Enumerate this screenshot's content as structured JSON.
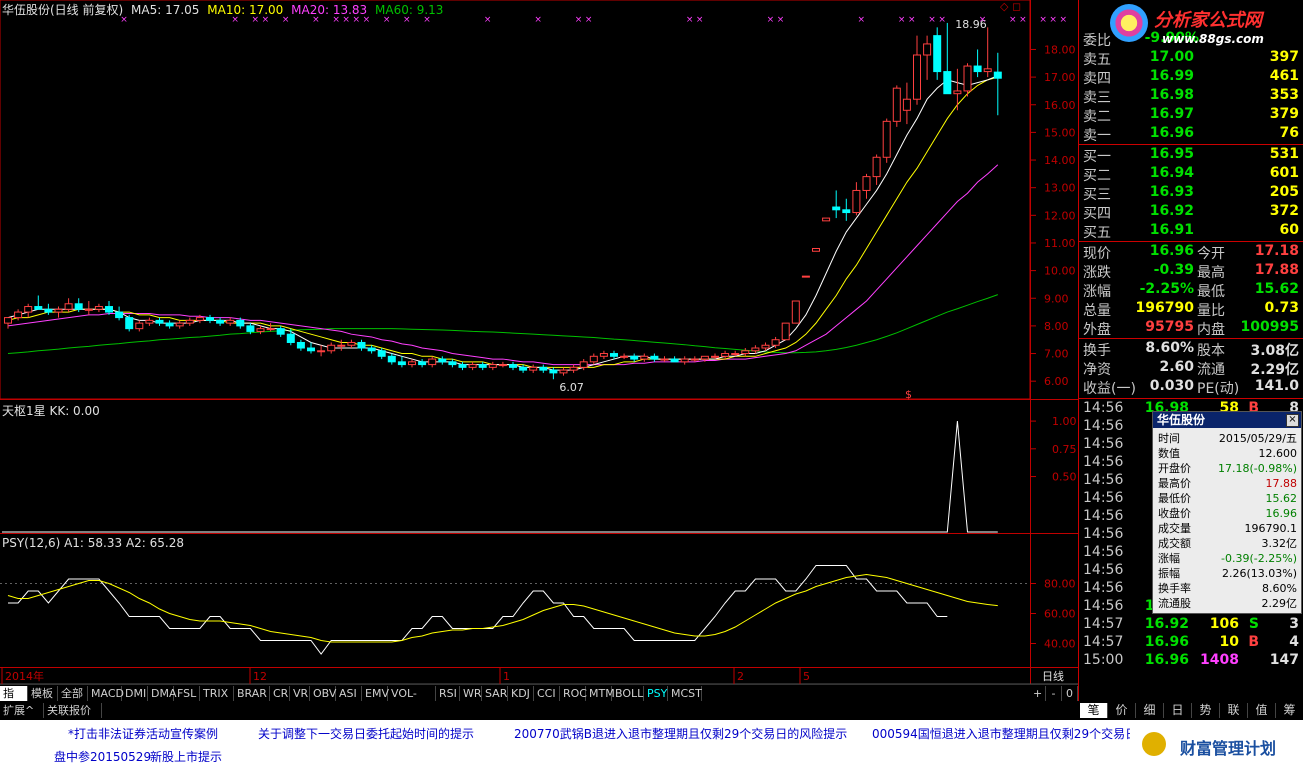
{
  "header": {
    "stock_title": "华伍股份(日线 前复权)",
    "ma5": "MA5: 17.05",
    "ma10": "MA10: 17.00",
    "ma20": "MA20: 13.83",
    "ma60": "MA60: 9.13"
  },
  "price_axis": [
    "18.00",
    "17.00",
    "16.00",
    "15.00",
    "14.00",
    "13.00",
    "12.00",
    "11.00",
    "10.00",
    "9.00",
    "8.00",
    "7.00",
    "6.00"
  ],
  "annotations": {
    "high": "18.96",
    "low": "6.07",
    "marker": "$"
  },
  "indicator1": {
    "title": "天枢1星  KK: 0.00",
    "axis": [
      "1.00",
      "0.75",
      "0.50"
    ]
  },
  "indicator2": {
    "title": "PSY(12,6)  A1: 58.33  A2: 65.28",
    "axis": [
      "80.00",
      "60.00",
      "40.00"
    ]
  },
  "time_axis": {
    "year": "2014年",
    "m12": "12",
    "m1": "1",
    "m2": "2",
    "m5": "5",
    "period": "日线"
  },
  "tabs": [
    "指标",
    "模板",
    "全部",
    "MACD",
    "DMI",
    "DMA",
    "FSL",
    "TRIX",
    "BRAR",
    "CR",
    "VR",
    "OBV",
    "ASI",
    "EMV",
    "VOL-TDX",
    "RSI",
    "WR",
    "SAR",
    "KDJ",
    "CCI",
    "ROC",
    "MTM",
    "BOLL",
    "PSY",
    "MCST"
  ],
  "tab_controls": [
    "+",
    "-",
    "0"
  ],
  "ext_tabs": [
    "扩展^",
    "关联报价"
  ],
  "order_book": {
    "header_label": "委比",
    "header_value": "-9.90%",
    "sell": [
      {
        "label": "卖五",
        "price": "17.00",
        "vol": "397"
      },
      {
        "label": "卖四",
        "price": "16.99",
        "vol": "461"
      },
      {
        "label": "卖三",
        "price": "16.98",
        "vol": "353"
      },
      {
        "label": "卖二",
        "price": "16.97",
        "vol": "379"
      },
      {
        "label": "卖一",
        "price": "16.96",
        "vol": "76"
      }
    ],
    "buy": [
      {
        "label": "买一",
        "price": "16.95",
        "vol": "531"
      },
      {
        "label": "买二",
        "price": "16.94",
        "vol": "601"
      },
      {
        "label": "买三",
        "price": "16.93",
        "vol": "205"
      },
      {
        "label": "买四",
        "price": "16.92",
        "vol": "372"
      },
      {
        "label": "买五",
        "price": "16.91",
        "vol": "60"
      }
    ]
  },
  "quote": [
    {
      "l1": "现价",
      "v1": "16.96",
      "l2": "今开",
      "v2": "17.18"
    },
    {
      "l1": "涨跌",
      "v1": "-0.39",
      "l2": "最高",
      "v2": "17.88"
    },
    {
      "l1": "涨幅",
      "v1": "-2.25%",
      "l2": "最低",
      "v2": "15.62"
    },
    {
      "l1": "总量",
      "v1": "196790",
      "l2": "量比",
      "v2": "0.73"
    },
    {
      "l1": "外盘",
      "v1": "95795",
      "l2": "内盘",
      "v2": "100995"
    }
  ],
  "fundamentals": [
    {
      "l1": "换手",
      "v1": "8.60%",
      "l2": "股本",
      "v2": "3.08亿"
    },
    {
      "l1": "净资",
      "v1": "2.60",
      "l2": "流通",
      "v2": "2.29亿"
    },
    {
      "l1": "收益(一)",
      "v1": "0.030",
      "l2": "PE(动)",
      "v2": "141.0"
    }
  ],
  "ticks": [
    {
      "t": "14:56",
      "p": "16.98",
      "v": "58",
      "f": "B",
      "n": "8"
    },
    {
      "t": "14:56",
      "p": "",
      "v": "",
      "f": "",
      "n": ""
    },
    {
      "t": "14:56",
      "p": "",
      "v": "",
      "f": "",
      "n": ""
    },
    {
      "t": "14:56",
      "p": "",
      "v": "",
      "f": "",
      "n": ""
    },
    {
      "t": "14:56",
      "p": "",
      "v": "",
      "f": "",
      "n": ""
    },
    {
      "t": "14:56",
      "p": "",
      "v": "",
      "f": "",
      "n": ""
    },
    {
      "t": "14:56",
      "p": "",
      "v": "",
      "f": "",
      "n": ""
    },
    {
      "t": "14:56",
      "p": "",
      "v": "",
      "f": "",
      "n": ""
    },
    {
      "t": "14:56",
      "p": "",
      "v": "",
      "f": "",
      "n": ""
    },
    {
      "t": "14:56",
      "p": "",
      "v": "",
      "f": "",
      "n": ""
    },
    {
      "t": "14:56",
      "p": "",
      "v": "",
      "f": "",
      "n": ""
    },
    {
      "t": "14:56",
      "p": "16.92",
      "v": "31",
      "f": "S",
      "n": "6"
    },
    {
      "t": "14:57",
      "p": "16.92",
      "v": "106",
      "f": "S",
      "n": "3"
    },
    {
      "t": "14:57",
      "p": "16.96",
      "v": "10",
      "f": "B",
      "n": "4"
    },
    {
      "t": "15:00",
      "p": "16.96",
      "v": "1408",
      "f": "",
      "n": "147"
    }
  ],
  "popup": {
    "title": "华伍股份",
    "close": "×",
    "rows": [
      {
        "k": "时间",
        "v": "2015/05/29/五"
      },
      {
        "k": "数值",
        "v": "12.600"
      },
      {
        "k": "开盘价",
        "v": "17.18(-0.98%)"
      },
      {
        "k": "最高价",
        "v": "17.88"
      },
      {
        "k": "最低价",
        "v": "15.62"
      },
      {
        "k": "收盘价",
        "v": "16.96"
      },
      {
        "k": "成交量",
        "v": "196790.1"
      },
      {
        "k": "成交额",
        "v": "3.32亿"
      },
      {
        "k": "涨幅",
        "v": "-0.39(-2.25%)"
      },
      {
        "k": "振幅",
        "v": "2.26(13.03%)"
      },
      {
        "k": "换手率",
        "v": "8.60%"
      },
      {
        "k": "流通股",
        "v": "2.29亿"
      }
    ]
  },
  "bottom_tabs": [
    "笔",
    "价",
    "细",
    "日",
    "势",
    "联",
    "值",
    "筹"
  ],
  "news": [
    "*打击非法证券活动宣传案例",
    "关于调整下一交易日委托起始时间的提示",
    "200770武锅B退进入退市整理期且仅剩29个交易日的风险提示",
    "000594国恒退进入退市整理期且仅剩29个交易日的",
    "盘中参20150529",
    "新股上市提示"
  ],
  "watermark": {
    "brand": "分析家公式网",
    "url": "www.88gs.com",
    "plan": "财富管理计划"
  },
  "colors": {
    "up": "#ff4040",
    "down": "#00ffff",
    "ma5": "#ffffff",
    "ma10": "#ffff00",
    "ma20": "#ff40ff",
    "ma60": "#00c000",
    "grid": "#c00000"
  },
  "chart_data": {
    "type": "candlestick",
    "ylim": [
      5.5,
      19.5
    ],
    "candles": [
      [
        8.1,
        8.3,
        7.9,
        8.3
      ],
      [
        8.3,
        8.6,
        8.2,
        8.5
      ],
      [
        8.5,
        8.8,
        8.3,
        8.7
      ],
      [
        8.7,
        9.1,
        8.6,
        8.6
      ],
      [
        8.6,
        8.8,
        8.4,
        8.5
      ],
      [
        8.5,
        8.7,
        8.3,
        8.6
      ],
      [
        8.6,
        9.0,
        8.5,
        8.8
      ],
      [
        8.8,
        9.0,
        8.5,
        8.6
      ],
      [
        8.6,
        8.9,
        8.4,
        8.6
      ],
      [
        8.6,
        8.8,
        8.5,
        8.7
      ],
      [
        8.7,
        8.9,
        8.4,
        8.5
      ],
      [
        8.5,
        8.7,
        8.2,
        8.3
      ],
      [
        8.3,
        8.4,
        7.8,
        7.9
      ],
      [
        7.9,
        8.2,
        7.8,
        8.1
      ],
      [
        8.1,
        8.3,
        8.0,
        8.2
      ],
      [
        8.2,
        8.3,
        8.0,
        8.1
      ],
      [
        8.1,
        8.2,
        7.9,
        8.0
      ],
      [
        8.0,
        8.2,
        7.9,
        8.1
      ],
      [
        8.1,
        8.3,
        8.0,
        8.2
      ],
      [
        8.2,
        8.4,
        8.1,
        8.3
      ],
      [
        8.3,
        8.4,
        8.1,
        8.2
      ],
      [
        8.2,
        8.3,
        8.0,
        8.1
      ],
      [
        8.1,
        8.3,
        8.0,
        8.2
      ],
      [
        8.2,
        8.3,
        7.9,
        8.0
      ],
      [
        8.0,
        8.1,
        7.7,
        7.8
      ],
      [
        7.8,
        8.0,
        7.7,
        7.9
      ],
      [
        7.9,
        8.1,
        7.8,
        7.9
      ],
      [
        7.9,
        8.0,
        7.6,
        7.7
      ],
      [
        7.7,
        7.9,
        7.3,
        7.4
      ],
      [
        7.4,
        7.5,
        7.1,
        7.2
      ],
      [
        7.2,
        7.4,
        7.0,
        7.1
      ],
      [
        7.1,
        7.3,
        6.9,
        7.1
      ],
      [
        7.1,
        7.4,
        7.0,
        7.3
      ],
      [
        7.3,
        7.5,
        7.1,
        7.3
      ],
      [
        7.3,
        7.5,
        7.2,
        7.4
      ],
      [
        7.4,
        7.5,
        7.1,
        7.2
      ],
      [
        7.2,
        7.3,
        7.0,
        7.1
      ],
      [
        7.1,
        7.2,
        6.8,
        6.9
      ],
      [
        6.9,
        7.0,
        6.6,
        6.7
      ],
      [
        6.7,
        6.9,
        6.5,
        6.6
      ],
      [
        6.6,
        6.8,
        6.5,
        6.7
      ],
      [
        6.7,
        6.8,
        6.5,
        6.6
      ],
      [
        6.6,
        6.9,
        6.5,
        6.8
      ],
      [
        6.8,
        6.9,
        6.6,
        6.7
      ],
      [
        6.7,
        6.8,
        6.5,
        6.6
      ],
      [
        6.6,
        6.7,
        6.4,
        6.5
      ],
      [
        6.5,
        6.7,
        6.4,
        6.6
      ],
      [
        6.6,
        6.7,
        6.4,
        6.5
      ],
      [
        6.5,
        6.7,
        6.4,
        6.6
      ],
      [
        6.6,
        6.7,
        6.5,
        6.6
      ],
      [
        6.6,
        6.7,
        6.4,
        6.5
      ],
      [
        6.5,
        6.6,
        6.3,
        6.4
      ],
      [
        6.4,
        6.6,
        6.3,
        6.5
      ],
      [
        6.5,
        6.6,
        6.3,
        6.4
      ],
      [
        6.4,
        6.5,
        6.07,
        6.3
      ],
      [
        6.3,
        6.5,
        6.2,
        6.4
      ],
      [
        6.4,
        6.6,
        6.3,
        6.5
      ],
      [
        6.5,
        6.8,
        6.4,
        6.7
      ],
      [
        6.7,
        7.0,
        6.6,
        6.9
      ],
      [
        6.9,
        7.1,
        6.8,
        7.0
      ],
      [
        7.0,
        7.1,
        6.8,
        6.9
      ],
      [
        6.9,
        7.0,
        6.8,
        6.9
      ],
      [
        6.9,
        7.0,
        6.7,
        6.8
      ],
      [
        6.8,
        7.0,
        6.7,
        6.9
      ],
      [
        6.9,
        7.0,
        6.7,
        6.8
      ],
      [
        6.8,
        6.9,
        6.7,
        6.8
      ],
      [
        6.8,
        6.9,
        6.7,
        6.7
      ],
      [
        6.7,
        6.9,
        6.6,
        6.8
      ],
      [
        6.8,
        6.9,
        6.7,
        6.8
      ],
      [
        6.8,
        6.9,
        6.7,
        6.9
      ],
      [
        6.9,
        7.0,
        6.8,
        6.9
      ],
      [
        6.9,
        7.1,
        6.8,
        7.0
      ],
      [
        7.0,
        7.1,
        6.9,
        7.0
      ],
      [
        7.0,
        7.2,
        6.9,
        7.1
      ],
      [
        7.1,
        7.3,
        7.0,
        7.2
      ],
      [
        7.2,
        7.4,
        7.1,
        7.3
      ],
      [
        7.3,
        7.6,
        7.2,
        7.5
      ],
      [
        7.5,
        8.1,
        7.5,
        8.1
      ],
      [
        8.1,
        8.9,
        8.1,
        8.9
      ],
      [
        9.8,
        9.8,
        9.8,
        9.8
      ],
      [
        10.7,
        10.8,
        10.7,
        10.8
      ],
      [
        11.8,
        11.9,
        11.8,
        11.9
      ],
      [
        12.3,
        12.9,
        11.9,
        12.2
      ],
      [
        12.2,
        12.6,
        11.8,
        12.1
      ],
      [
        12.1,
        13.2,
        12.0,
        12.9
      ],
      [
        12.9,
        13.5,
        12.6,
        13.4
      ],
      [
        13.4,
        14.2,
        13.1,
        14.1
      ],
      [
        14.1,
        15.5,
        13.9,
        15.4
      ],
      [
        15.4,
        16.7,
        15.2,
        16.6
      ],
      [
        15.8,
        16.8,
        15.3,
        16.2
      ],
      [
        16.2,
        18.5,
        16.0,
        17.8
      ],
      [
        17.8,
        18.5,
        16.9,
        18.2
      ],
      [
        18.5,
        18.8,
        16.9,
        17.2
      ],
      [
        17.2,
        18.96,
        16.4,
        16.4
      ],
      [
        16.4,
        17.3,
        15.8,
        16.5
      ],
      [
        16.5,
        17.5,
        16.3,
        17.4
      ],
      [
        17.4,
        18.0,
        17.0,
        17.2
      ],
      [
        17.2,
        18.8,
        17.0,
        17.3
      ],
      [
        17.18,
        17.88,
        15.62,
        16.96
      ]
    ],
    "ma5": [
      8.3,
      8.4,
      8.5,
      8.6,
      8.6,
      8.6,
      8.6,
      8.6,
      8.6,
      8.6,
      8.6,
      8.5,
      8.3,
      8.2,
      8.2,
      8.1,
      8.1,
      8.1,
      8.1,
      8.2,
      8.2,
      8.2,
      8.2,
      8.1,
      8.1,
      8.0,
      7.9,
      7.9,
      7.8,
      7.6,
      7.4,
      7.3,
      7.2,
      7.2,
      7.2,
      7.2,
      7.2,
      7.1,
      7.0,
      6.9,
      6.8,
      6.7,
      6.7,
      6.7,
      6.7,
      6.6,
      6.6,
      6.6,
      6.6,
      6.6,
      6.6,
      6.5,
      6.5,
      6.5,
      6.4,
      6.4,
      6.4,
      6.5,
      6.6,
      6.7,
      6.8,
      6.9,
      6.9,
      6.9,
      6.8,
      6.8,
      6.8,
      6.8,
      6.8,
      6.8,
      6.8,
      6.9,
      6.9,
      7.0,
      7.0,
      7.1,
      7.3,
      7.5,
      7.9,
      8.4,
      9.1,
      9.9,
      10.7,
      11.4,
      11.9,
      12.4,
      12.9,
      13.5,
      14.2,
      14.9,
      15.5,
      16.2,
      16.6,
      16.9,
      16.8,
      16.7,
      16.8,
      16.9,
      17.05
    ],
    "ma10": [
      8.2,
      8.3,
      8.3,
      8.4,
      8.5,
      8.5,
      8.5,
      8.6,
      8.6,
      8.6,
      8.6,
      8.5,
      8.5,
      8.4,
      8.4,
      8.3,
      8.3,
      8.2,
      8.2,
      8.2,
      8.2,
      8.2,
      8.1,
      8.1,
      8.1,
      8.1,
      8.0,
      8.0,
      7.9,
      7.8,
      7.7,
      7.6,
      7.5,
      7.4,
      7.4,
      7.3,
      7.3,
      7.2,
      7.1,
      7.0,
      7.0,
      6.9,
      6.9,
      6.8,
      6.8,
      6.7,
      6.7,
      6.7,
      6.6,
      6.6,
      6.6,
      6.6,
      6.5,
      6.5,
      6.5,
      6.5,
      6.5,
      6.5,
      6.5,
      6.6,
      6.6,
      6.7,
      6.7,
      6.8,
      6.8,
      6.8,
      6.8,
      6.8,
      6.8,
      6.8,
      6.8,
      6.8,
      6.9,
      6.9,
      6.9,
      7.0,
      7.1,
      7.2,
      7.4,
      7.7,
      8.1,
      8.6,
      9.1,
      9.7,
      10.2,
      10.8,
      11.4,
      12.0,
      12.6,
      13.2,
      13.7,
      14.3,
      14.9,
      15.5,
      16.0,
      16.4,
      16.7,
      16.9,
      17.0
    ],
    "ma20": [
      8.0,
      8.05,
      8.1,
      8.15,
      8.2,
      8.25,
      8.3,
      8.35,
      8.4,
      8.4,
      8.45,
      8.45,
      8.45,
      8.45,
      8.45,
      8.4,
      8.4,
      8.4,
      8.35,
      8.35,
      8.3,
      8.3,
      8.3,
      8.25,
      8.2,
      8.2,
      8.15,
      8.1,
      8.05,
      8.0,
      7.95,
      7.9,
      7.85,
      7.8,
      7.7,
      7.65,
      7.6,
      7.5,
      7.45,
      7.35,
      7.3,
      7.2,
      7.15,
      7.1,
      7.0,
      6.95,
      6.9,
      6.85,
      6.8,
      6.8,
      6.75,
      6.7,
      6.7,
      6.65,
      6.6,
      6.6,
      6.6,
      6.6,
      6.6,
      6.6,
      6.6,
      6.6,
      6.65,
      6.65,
      6.7,
      6.7,
      6.7,
      6.7,
      6.7,
      6.75,
      6.75,
      6.8,
      6.8,
      6.8,
      6.85,
      6.9,
      6.95,
      7.0,
      7.1,
      7.3,
      7.5,
      7.7,
      8.0,
      8.3,
      8.6,
      8.9,
      9.3,
      9.7,
      10.1,
      10.5,
      10.9,
      11.3,
      11.7,
      12.1,
      12.5,
      12.8,
      13.2,
      13.5,
      13.83
    ],
    "ma60": [
      7.0,
      7.03,
      7.06,
      7.1,
      7.13,
      7.16,
      7.2,
      7.23,
      7.26,
      7.3,
      7.33,
      7.36,
      7.4,
      7.43,
      7.46,
      7.5,
      7.52,
      7.55,
      7.58,
      7.6,
      7.63,
      7.66,
      7.7,
      7.72,
      7.75,
      7.78,
      7.8,
      7.82,
      7.84,
      7.86,
      7.87,
      7.88,
      7.9,
      7.9,
      7.9,
      7.9,
      7.9,
      7.9,
      7.9,
      7.89,
      7.88,
      7.87,
      7.86,
      7.85,
      7.84,
      7.82,
      7.8,
      7.79,
      7.78,
      7.76,
      7.74,
      7.72,
      7.7,
      7.68,
      7.66,
      7.64,
      7.62,
      7.6,
      7.58,
      7.55,
      7.52,
      7.5,
      7.47,
      7.44,
      7.41,
      7.38,
      7.35,
      7.32,
      7.28,
      7.25,
      7.21,
      7.18,
      7.15,
      7.12,
      7.09,
      7.06,
      7.04,
      7.03,
      7.03,
      7.04,
      7.06,
      7.1,
      7.15,
      7.22,
      7.3,
      7.4,
      7.5,
      7.62,
      7.75,
      7.9,
      8.05,
      8.2,
      8.35,
      8.5,
      8.62,
      8.75,
      8.88,
      9.0,
      9.13
    ],
    "kk": {
      "spike_index": 94,
      "values_baseline": 0,
      "spike_value": 1.0,
      "ylim": [
        0,
        1.1
      ]
    },
    "psy_a1": [
      67,
      67,
      75,
      75,
      67,
      75,
      83,
      83,
      83,
      83,
      75,
      67,
      58,
      58,
      58,
      58,
      50,
      50,
      50,
      50,
      58,
      58,
      50,
      50,
      50,
      42,
      42,
      42,
      42,
      42,
      42,
      33,
      42,
      42,
      42,
      42,
      42,
      42,
      42,
      42,
      50,
      50,
      58,
      58,
      50,
      50,
      50,
      50,
      50,
      58,
      58,
      67,
      75,
      75,
      67,
      67,
      58,
      58,
      50,
      50,
      50,
      50,
      42,
      42,
      42,
      42,
      42,
      42,
      42,
      50,
      58,
      67,
      75,
      75,
      83,
      83,
      83,
      75,
      75,
      83,
      92,
      92,
      92,
      92,
      83,
      83,
      75,
      75,
      75,
      67,
      67,
      67,
      58,
      58
    ],
    "psy_a2": [
      72,
      70,
      70,
      72,
      74,
      76,
      78,
      80,
      82,
      82,
      80,
      77,
      74,
      70,
      67,
      63,
      60,
      58,
      56,
      55,
      55,
      55,
      54,
      53,
      52,
      50,
      48,
      47,
      46,
      45,
      44,
      42,
      41,
      41,
      41,
      41,
      41,
      41,
      41,
      42,
      44,
      45,
      47,
      48,
      49,
      49,
      50,
      50,
      51,
      52,
      54,
      56,
      59,
      62,
      64,
      66,
      66,
      65,
      63,
      61,
      59,
      57,
      55,
      53,
      51,
      49,
      47,
      46,
      45,
      45,
      46,
      48,
      51,
      55,
      59,
      63,
      67,
      70,
      73,
      75,
      78,
      80,
      82,
      84,
      85,
      86,
      85,
      84,
      82,
      80,
      78,
      76,
      74,
      72,
      70,
      68,
      67,
      66,
      65.28
    ],
    "psy_ylim": [
      25,
      105
    ]
  }
}
